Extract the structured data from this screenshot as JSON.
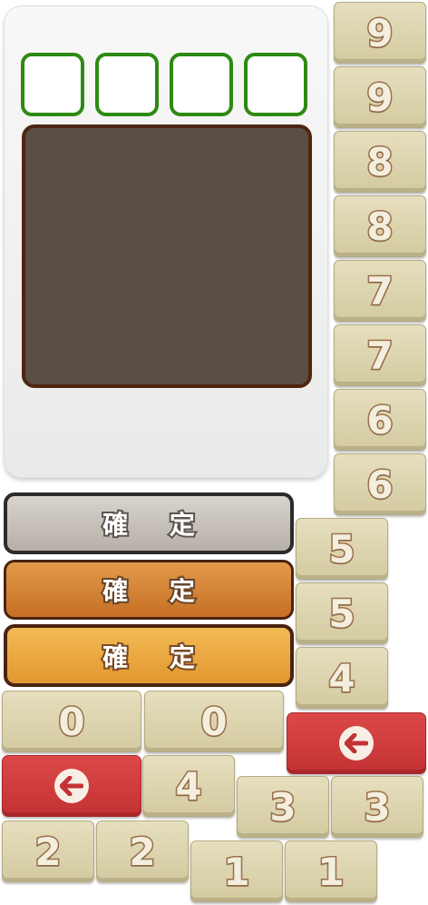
{
  "confirm_label": "確 定",
  "pad": {
    "k9": "9",
    "k8": "8",
    "k7": "7",
    "k6": "6",
    "k5": "5",
    "k4": "4",
    "k3": "3",
    "k2": "2",
    "k1": "1",
    "k0": "0"
  },
  "colors": {
    "slot_border": "#2d8a12",
    "screen_fill": "#5b4e45",
    "screen_border": "#4e2612",
    "key_face": "#e6dfbe",
    "digit_outline": "#9a6f4c",
    "delete_red": "#d63d3f",
    "confirm_gray": "#c8c2bc",
    "confirm_orange_dark": "#d6832f",
    "confirm_orange_light": "#eba944"
  },
  "icons": {
    "delete": "arrow-left-icon"
  }
}
